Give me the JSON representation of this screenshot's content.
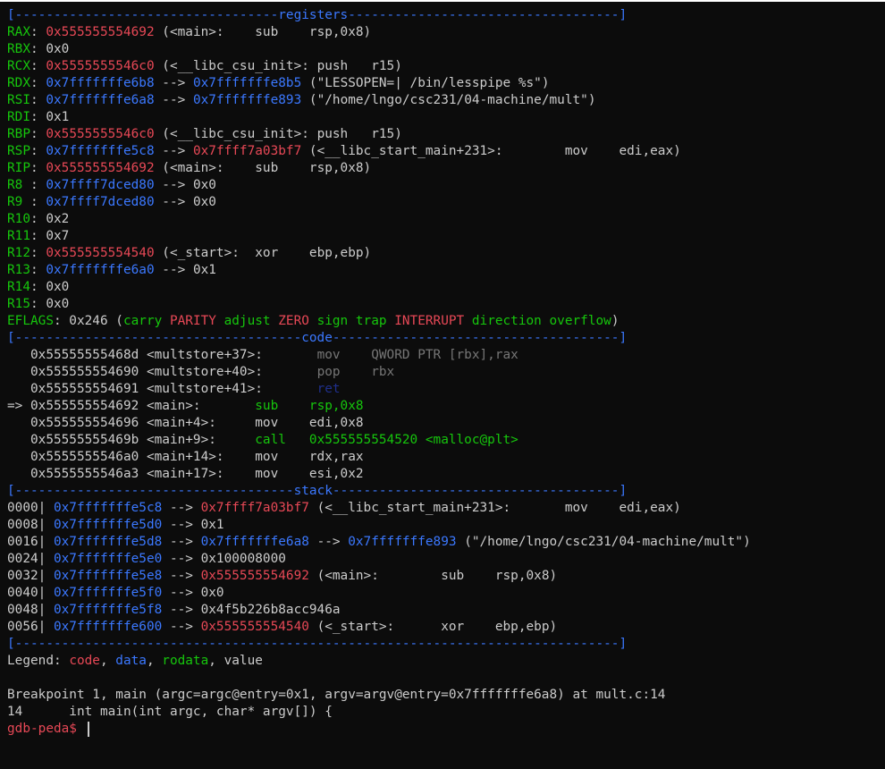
{
  "lines": [
    {
      "name": "registers-header",
      "segs": [
        {
          "t": "[----------------------------------",
          "c": "b"
        },
        {
          "t": "registers",
          "c": "b"
        },
        {
          "t": "-----------------------------------]",
          "c": "b"
        }
      ]
    },
    {
      "name": "reg-rax",
      "segs": [
        {
          "t": "RAX",
          "c": "g"
        },
        {
          "t": ": ",
          "c": "w"
        },
        {
          "t": "0x555555554692",
          "c": "r"
        },
        {
          "t": " (<main>:    sub    rsp,0x8)",
          "c": "w"
        }
      ]
    },
    {
      "name": "reg-rbx",
      "segs": [
        {
          "t": "RBX",
          "c": "g"
        },
        {
          "t": ": 0x0",
          "c": "w"
        }
      ]
    },
    {
      "name": "reg-rcx",
      "segs": [
        {
          "t": "RCX",
          "c": "g"
        },
        {
          "t": ": ",
          "c": "w"
        },
        {
          "t": "0x5555555546c0",
          "c": "r"
        },
        {
          "t": " (<__libc_csu_init>: push   r15)",
          "c": "w"
        }
      ]
    },
    {
      "name": "reg-rdx",
      "segs": [
        {
          "t": "RDX",
          "c": "g"
        },
        {
          "t": ": ",
          "c": "w"
        },
        {
          "t": "0x7fffffffe6b8",
          "c": "b"
        },
        {
          "t": " --> ",
          "c": "w"
        },
        {
          "t": "0x7fffffffe8b5",
          "c": "b"
        },
        {
          "t": " (\"LESSOPEN=| /bin/lesspipe %s\")",
          "c": "w"
        }
      ]
    },
    {
      "name": "reg-rsi",
      "segs": [
        {
          "t": "RSI",
          "c": "g"
        },
        {
          "t": ": ",
          "c": "w"
        },
        {
          "t": "0x7fffffffe6a8",
          "c": "b"
        },
        {
          "t": " --> ",
          "c": "w"
        },
        {
          "t": "0x7fffffffe893",
          "c": "b"
        },
        {
          "t": " (\"/home/lngo/csc231/04-machine/mult\")",
          "c": "w"
        }
      ]
    },
    {
      "name": "reg-rdi",
      "segs": [
        {
          "t": "RDI",
          "c": "g"
        },
        {
          "t": ": 0x1",
          "c": "w"
        }
      ]
    },
    {
      "name": "reg-rbp",
      "segs": [
        {
          "t": "RBP",
          "c": "g"
        },
        {
          "t": ": ",
          "c": "w"
        },
        {
          "t": "0x5555555546c0",
          "c": "r"
        },
        {
          "t": " (<__libc_csu_init>: push   r15)",
          "c": "w"
        }
      ]
    },
    {
      "name": "reg-rsp",
      "segs": [
        {
          "t": "RSP",
          "c": "g"
        },
        {
          "t": ": ",
          "c": "w"
        },
        {
          "t": "0x7fffffffe5c8",
          "c": "b"
        },
        {
          "t": " --> ",
          "c": "w"
        },
        {
          "t": "0x7ffff7a03bf7",
          "c": "r"
        },
        {
          "t": " (<__libc_start_main+231>:        mov    edi,eax)",
          "c": "w"
        }
      ]
    },
    {
      "name": "reg-rip",
      "segs": [
        {
          "t": "RIP",
          "c": "g"
        },
        {
          "t": ": ",
          "c": "w"
        },
        {
          "t": "0x555555554692",
          "c": "r"
        },
        {
          "t": " (<main>:    sub    rsp,0x8)",
          "c": "w"
        }
      ]
    },
    {
      "name": "reg-r8",
      "segs": [
        {
          "t": "R8 ",
          "c": "g"
        },
        {
          "t": ": ",
          "c": "w"
        },
        {
          "t": "0x7ffff7dced80",
          "c": "b"
        },
        {
          "t": " --> 0x0",
          "c": "w"
        }
      ]
    },
    {
      "name": "reg-r9",
      "segs": [
        {
          "t": "R9 ",
          "c": "g"
        },
        {
          "t": ": ",
          "c": "w"
        },
        {
          "t": "0x7ffff7dced80",
          "c": "b"
        },
        {
          "t": " --> 0x0",
          "c": "w"
        }
      ]
    },
    {
      "name": "reg-r10",
      "segs": [
        {
          "t": "R10",
          "c": "g"
        },
        {
          "t": ": 0x2",
          "c": "w"
        }
      ]
    },
    {
      "name": "reg-r11",
      "segs": [
        {
          "t": "R11",
          "c": "g"
        },
        {
          "t": ": 0x7",
          "c": "w"
        }
      ]
    },
    {
      "name": "reg-r12",
      "segs": [
        {
          "t": "R12",
          "c": "g"
        },
        {
          "t": ": ",
          "c": "w"
        },
        {
          "t": "0x555555554540",
          "c": "r"
        },
        {
          "t": " (<_start>:  xor    ebp,ebp)",
          "c": "w"
        }
      ]
    },
    {
      "name": "reg-r13",
      "segs": [
        {
          "t": "R13",
          "c": "g"
        },
        {
          "t": ": ",
          "c": "w"
        },
        {
          "t": "0x7fffffffe6a0",
          "c": "b"
        },
        {
          "t": " --> 0x1",
          "c": "w"
        }
      ]
    },
    {
      "name": "reg-r14",
      "segs": [
        {
          "t": "R14",
          "c": "g"
        },
        {
          "t": ": 0x0",
          "c": "w"
        }
      ]
    },
    {
      "name": "reg-r15",
      "segs": [
        {
          "t": "R15",
          "c": "g"
        },
        {
          "t": ": 0x0",
          "c": "w"
        }
      ]
    },
    {
      "name": "reg-eflags",
      "segs": [
        {
          "t": "EFLAGS",
          "c": "g"
        },
        {
          "t": ": 0x246 (",
          "c": "w"
        },
        {
          "t": "carry ",
          "c": "g"
        },
        {
          "t": "PARITY",
          "c": "r"
        },
        {
          "t": " adjust ",
          "c": "g"
        },
        {
          "t": "ZERO",
          "c": "r"
        },
        {
          "t": " sign trap ",
          "c": "g"
        },
        {
          "t": "INTERRUPT",
          "c": "r"
        },
        {
          "t": " direction overflow",
          "c": "g"
        },
        {
          "t": ")",
          "c": "w"
        }
      ]
    },
    {
      "name": "code-header",
      "segs": [
        {
          "t": "[-------------------------------------",
          "c": "b"
        },
        {
          "t": "code",
          "c": "b"
        },
        {
          "t": "-------------------------------------]",
          "c": "b"
        }
      ]
    },
    {
      "name": "code-line",
      "segs": [
        {
          "t": "   0x55555555468d <multstore+37>:",
          "c": "w"
        },
        {
          "t": "       mov    QWORD PTR [rbx],rax",
          "c": "d"
        }
      ]
    },
    {
      "name": "code-line",
      "segs": [
        {
          "t": "   0x555555554690 <multstore+40>:",
          "c": "w"
        },
        {
          "t": "       pop    rbx",
          "c": "d"
        }
      ]
    },
    {
      "name": "code-line",
      "segs": [
        {
          "t": "   0x555555554691 <multstore+41>:",
          "c": "w"
        },
        {
          "t": "       ret",
          "c": "nb"
        }
      ]
    },
    {
      "name": "code-line-current",
      "segs": [
        {
          "t": "=> 0x555555554692 <main>:",
          "c": "w"
        },
        {
          "t": "       sub    rsp,0x8",
          "c": "g"
        }
      ]
    },
    {
      "name": "code-line",
      "segs": [
        {
          "t": "   0x555555554696 <main+4>:     mov    edi,0x8",
          "c": "w"
        }
      ]
    },
    {
      "name": "code-line",
      "segs": [
        {
          "t": "   0x55555555469b <main+9>:",
          "c": "w"
        },
        {
          "t": "     call   0x555555554520 <malloc@plt>",
          "c": "g"
        }
      ]
    },
    {
      "name": "code-line",
      "segs": [
        {
          "t": "   0x5555555546a0 <main+14>:    mov    rdx,rax",
          "c": "w"
        }
      ]
    },
    {
      "name": "code-line",
      "segs": [
        {
          "t": "   0x5555555546a3 <main+17>:    mov    esi,0x2",
          "c": "w"
        }
      ]
    },
    {
      "name": "stack-header",
      "segs": [
        {
          "t": "[------------------------------------",
          "c": "b"
        },
        {
          "t": "stack",
          "c": "b"
        },
        {
          "t": "-------------------------------------]",
          "c": "b"
        }
      ]
    },
    {
      "name": "stack-line",
      "segs": [
        {
          "t": "0000| ",
          "c": "w"
        },
        {
          "t": "0x7fffffffe5c8",
          "c": "b"
        },
        {
          "t": " --> ",
          "c": "w"
        },
        {
          "t": "0x7ffff7a03bf7",
          "c": "r"
        },
        {
          "t": " (<__libc_start_main+231>:       mov    edi,eax)",
          "c": "w"
        }
      ]
    },
    {
      "name": "stack-line",
      "segs": [
        {
          "t": "0008| ",
          "c": "w"
        },
        {
          "t": "0x7fffffffe5d0",
          "c": "b"
        },
        {
          "t": " --> 0x1",
          "c": "w"
        }
      ]
    },
    {
      "name": "stack-line",
      "segs": [
        {
          "t": "0016| ",
          "c": "w"
        },
        {
          "t": "0x7fffffffe5d8",
          "c": "b"
        },
        {
          "t": " --> ",
          "c": "w"
        },
        {
          "t": "0x7fffffffe6a8",
          "c": "b"
        },
        {
          "t": " --> ",
          "c": "w"
        },
        {
          "t": "0x7fffffffe893",
          "c": "b"
        },
        {
          "t": " (\"/home/lngo/csc231/04-machine/mult\")",
          "c": "w"
        }
      ]
    },
    {
      "name": "stack-line",
      "segs": [
        {
          "t": "0024| ",
          "c": "w"
        },
        {
          "t": "0x7fffffffe5e0",
          "c": "b"
        },
        {
          "t": " --> 0x100008000",
          "c": "w"
        }
      ]
    },
    {
      "name": "stack-line",
      "segs": [
        {
          "t": "0032| ",
          "c": "w"
        },
        {
          "t": "0x7fffffffe5e8",
          "c": "b"
        },
        {
          "t": " --> ",
          "c": "w"
        },
        {
          "t": "0x555555554692",
          "c": "r"
        },
        {
          "t": " (<main>:        sub    rsp,0x8)",
          "c": "w"
        }
      ]
    },
    {
      "name": "stack-line",
      "segs": [
        {
          "t": "0040| ",
          "c": "w"
        },
        {
          "t": "0x7fffffffe5f0",
          "c": "b"
        },
        {
          "t": " --> 0x0",
          "c": "w"
        }
      ]
    },
    {
      "name": "stack-line",
      "segs": [
        {
          "t": "0048| ",
          "c": "w"
        },
        {
          "t": "0x7fffffffe5f8",
          "c": "b"
        },
        {
          "t": " --> 0x4f5b226b8acc946a",
          "c": "w"
        }
      ]
    },
    {
      "name": "stack-line",
      "segs": [
        {
          "t": "0056| ",
          "c": "w"
        },
        {
          "t": "0x7fffffffe600",
          "c": "b"
        },
        {
          "t": " --> ",
          "c": "w"
        },
        {
          "t": "0x555555554540",
          "c": "r"
        },
        {
          "t": " (<_start>:      xor    ebp,ebp)",
          "c": "w"
        }
      ]
    },
    {
      "name": "footer-rule",
      "segs": [
        {
          "t": "[------------------------------------------------------------------------------]",
          "c": "b"
        }
      ]
    },
    {
      "name": "legend-line",
      "segs": [
        {
          "t": "Legend: ",
          "c": "w"
        },
        {
          "t": "code",
          "c": "r"
        },
        {
          "t": ", ",
          "c": "w"
        },
        {
          "t": "data",
          "c": "b"
        },
        {
          "t": ", ",
          "c": "w"
        },
        {
          "t": "rodata",
          "c": "g"
        },
        {
          "t": ", value",
          "c": "w"
        }
      ]
    },
    {
      "name": "blank-line",
      "segs": [
        {
          "t": " ",
          "c": "w"
        }
      ]
    },
    {
      "name": "breakpoint-line",
      "segs": [
        {
          "t": "Breakpoint 1, main (argc=argc@entry=0x1, argv=argv@entry=0x7fffffffe6a8) at mult.c:14",
          "c": "w"
        }
      ]
    },
    {
      "name": "source-line",
      "segs": [
        {
          "t": "14      int main(int argc, char* argv[]) {",
          "c": "w"
        }
      ]
    }
  ],
  "prompt": {
    "text": "gdb-peda$ "
  }
}
